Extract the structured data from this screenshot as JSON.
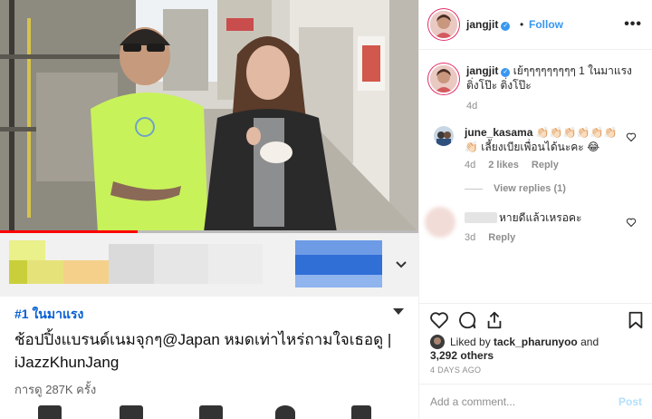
{
  "video": {
    "progress_fraction": 0.33
  },
  "yt": {
    "trend_label": "#1 ในมาแรง",
    "title": "ช้อปปิ้งแบรนด์เนมจุกๆ@Japan หมดเท่าไหร่ถามใจเธอดู | iJazzKhunJang",
    "views": "การดู 287K ครั้ง"
  },
  "post": {
    "username": "jangjit",
    "follow_label": "Follow",
    "more_label": "•••",
    "caption_user": "jangjit",
    "caption_text": "เย้ๆๆๆๆๆๆๆๆๆ 1 ในมาแรง ติ่งโป๊ะ ติ่งโป๊ะ",
    "caption_time": "4d",
    "comments": [
      {
        "user": "june_kasama",
        "text": "👏🏻👏🏻👏🏻👏🏻👏🏻👏🏻👏🏻 เลี้ยงเบียเพื่อนได้นะคะ 😂",
        "time": "4d",
        "likes": "2 likes",
        "reply": "Reply",
        "view_replies": "View replies (1)"
      },
      {
        "user": "",
        "text": "หายดีแล้วเหรอคะ",
        "time": "3d",
        "reply": "Reply"
      }
    ],
    "liked_by_prefix": "Liked by",
    "liked_by_user": "tack_pharunyoo",
    "liked_by_and": "and",
    "liked_by_count": "3,292 others",
    "date": "4 DAYS AGO",
    "add_comment_placeholder": "Add a comment...",
    "post_label": "Post"
  },
  "colors": {
    "accent": "#3897f0",
    "yt_link": "#065fd4",
    "progress": "#ff0000",
    "shirt": "#c8f25a"
  },
  "icons": [
    "verified-badge-icon",
    "heart-icon",
    "comment-icon",
    "share-icon",
    "bookmark-icon",
    "chevron-down-icon",
    "more-options-icon"
  ]
}
